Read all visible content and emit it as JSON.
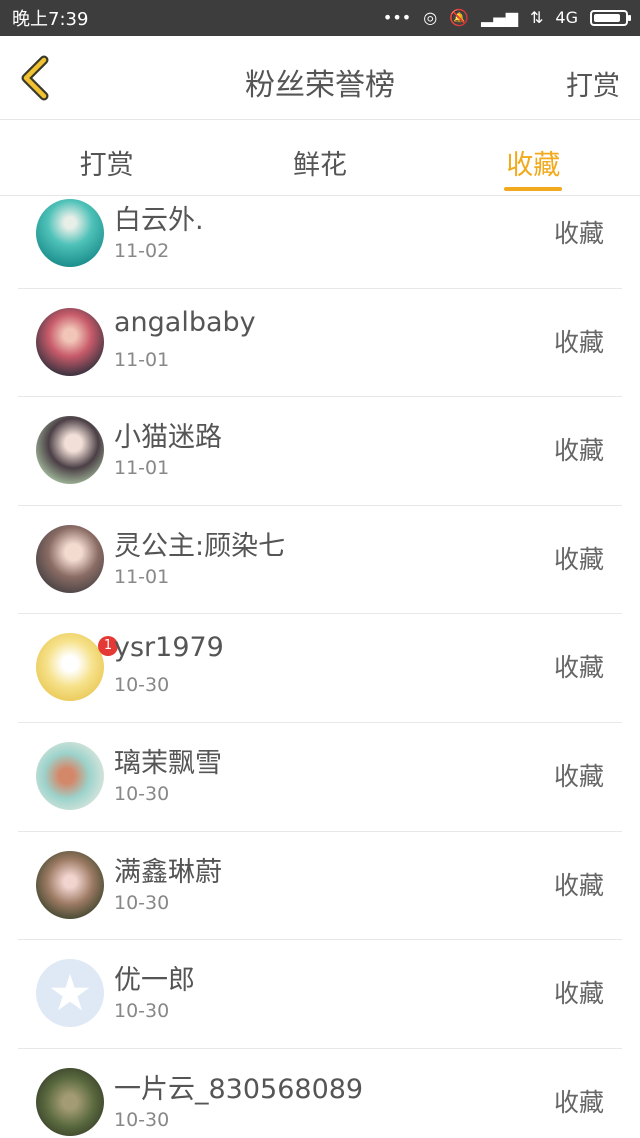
{
  "statusbar": {
    "time": "晚上7:39",
    "network": "4G",
    "icons": [
      "dots-icon",
      "sync-icon",
      "mute-icon",
      "signal-icon",
      "signal2-icon",
      "battery-icon"
    ]
  },
  "header": {
    "back_icon": "chevron-left-icon",
    "title": "粉丝荣誉榜",
    "action": "打赏"
  },
  "tabs": [
    {
      "label": "打赏",
      "active": false
    },
    {
      "label": "鲜花",
      "active": false
    },
    {
      "label": "收藏",
      "active": true
    }
  ],
  "accent_color": "#f1a91d",
  "list": [
    {
      "name": "白云外.",
      "date": "11-02",
      "action": "收藏"
    },
    {
      "name": "angalbaby",
      "date": "11-01",
      "action": "收藏"
    },
    {
      "name": "小猫迷路",
      "date": "11-01",
      "action": "收藏"
    },
    {
      "name": "灵公主:顾染七",
      "date": "11-01",
      "action": "收藏"
    },
    {
      "name": "ysr1979",
      "date": "10-30",
      "action": "收藏",
      "badge": "1"
    },
    {
      "name": "璃茉飘雪",
      "date": "10-30",
      "action": "收藏"
    },
    {
      "name": "满鑫琳蔚",
      "date": "10-30",
      "action": "收藏"
    },
    {
      "name": "优一郎",
      "date": "10-30",
      "action": "收藏"
    },
    {
      "name": "一片云_830568089",
      "date": "10-30",
      "action": "收藏"
    }
  ]
}
